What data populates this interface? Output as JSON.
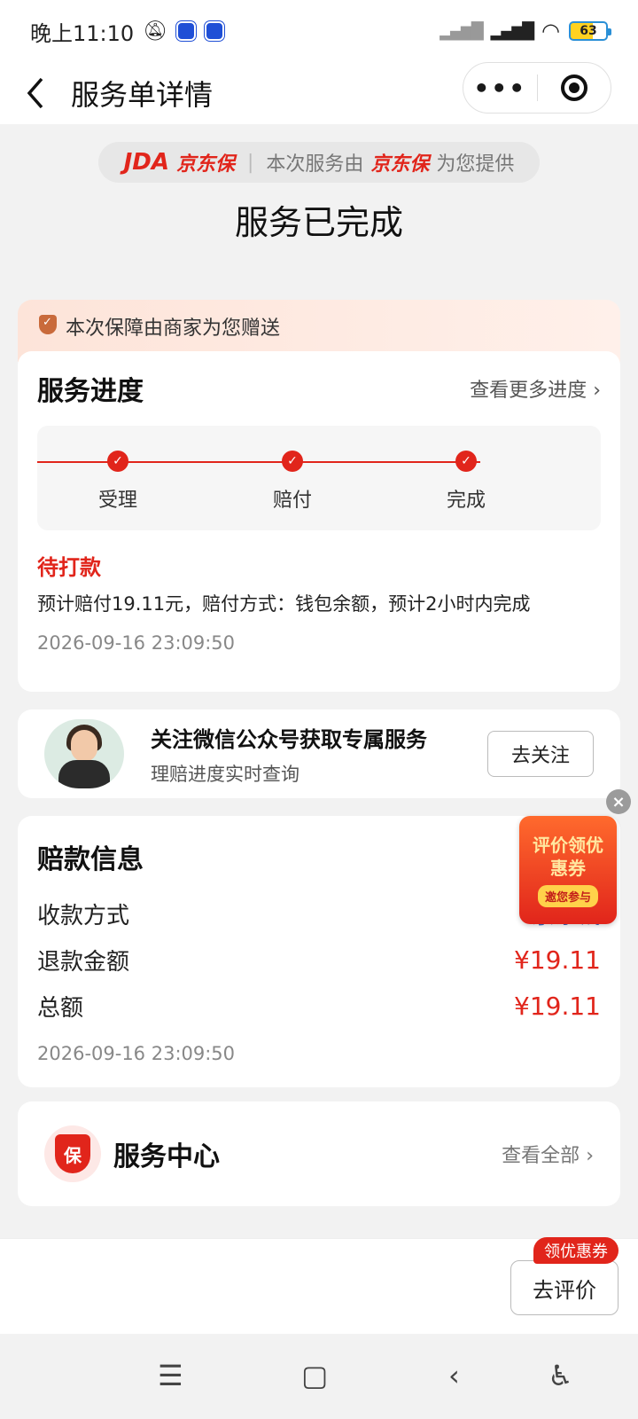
{
  "status_bar": {
    "time": "晚上11:10",
    "battery": "63"
  },
  "nav": {
    "title": "服务单详情",
    "more": "•••"
  },
  "provider": {
    "logo": "JDA",
    "brand": "京东保",
    "prefix": "本次服务由",
    "brand2": "京东保",
    "suffix": "为您提供"
  },
  "service_status": "服务已完成",
  "gift_banner": "本次保障由商家为您赠送",
  "progress": {
    "title": "服务进度",
    "more_link": "查看更多进度",
    "steps": [
      {
        "label": "受理"
      },
      {
        "label": "赔付"
      },
      {
        "label": "完成"
      }
    ],
    "status": "待打款",
    "description": "预计赔付19.11元，赔付方式：钱包余额，预计2小时内完成",
    "time": "2026-09-16 23:09:50"
  },
  "follow": {
    "title": "关注微信公众号获取专属服务",
    "subtitle": "理赔进度实时查询",
    "button": "去关注"
  },
  "payment": {
    "title": "赔款信息",
    "rows": [
      {
        "label": "收款方式",
        "value": "京东钱"
      },
      {
        "label": "退款金额",
        "value": "¥19.11"
      },
      {
        "label": "总额",
        "value": "¥19.11"
      }
    ],
    "time": "2026-09-16 23:09:50"
  },
  "promo": {
    "text": "评价领优惠券",
    "join": "邀您参与"
  },
  "service_center": {
    "badge": "保",
    "title": "服务中心",
    "link": "查看全部"
  },
  "bottom": {
    "coupon_tag": "领优惠券",
    "review_button": "去评价"
  },
  "colors": {
    "accent_red": "#e1251b",
    "link_blue": "#3a6bc4"
  }
}
